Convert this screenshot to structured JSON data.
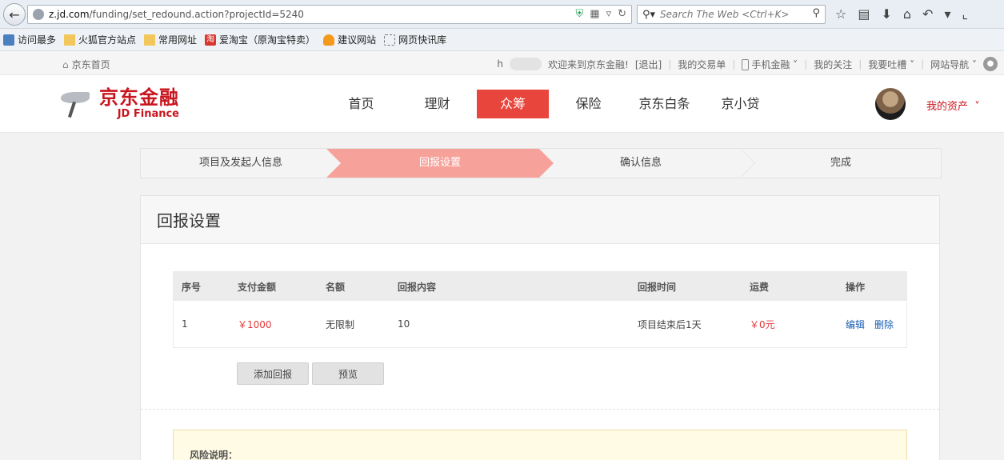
{
  "browser": {
    "url_host": "z.jd.com",
    "url_path": "/funding/set_redound.action?projectId=5240",
    "search_placeholder": "Search The Web <Ctrl+K>"
  },
  "bookmarks": [
    {
      "label": "访问最多",
      "icon": "most-visited-icon"
    },
    {
      "label": "火狐官方站点",
      "icon": "folder-icon"
    },
    {
      "label": "常用网址",
      "icon": "folder-icon"
    },
    {
      "label": "爱淘宝（原淘宝特卖）",
      "icon": "taobao-icon"
    },
    {
      "label": "建议网站",
      "icon": "bulb-icon"
    },
    {
      "label": "网页快讯库",
      "icon": "web-slice-icon"
    }
  ],
  "site_top": {
    "home": "京东首页",
    "user_initial": "h",
    "welcome": "欢迎来到京东金融!",
    "logout": "[退出]",
    "links": [
      "我的交易单",
      "手机金融",
      "我的关注",
      "我要吐槽",
      "网站导航"
    ]
  },
  "header": {
    "logo_cn": "京东金融",
    "logo_en": "JD Finance",
    "nav": [
      "首页",
      "理财",
      "众筹",
      "保险",
      "京东白条",
      "京小贷"
    ],
    "active_nav": "众筹",
    "my_assets": "我的资产"
  },
  "steps": [
    "项目及发起人信息",
    "回报设置",
    "确认信息",
    "完成"
  ],
  "panel": {
    "title": "回报设置",
    "table_headers": [
      "序号",
      "支付金额",
      "名额",
      "回报内容",
      "回报时间",
      "运费",
      "操作"
    ],
    "rows": [
      {
        "index": "1",
        "amount": "￥1000",
        "quota": "无限制",
        "content": "10",
        "time": "项目结束后1天",
        "shipping": "￥0元",
        "edit": "编辑",
        "delete": "删除"
      }
    ],
    "add_button": "添加回报",
    "preview_button": "预览",
    "risk_title": "风险说明："
  },
  "colors": {
    "brand_red": "#c9151e",
    "active_nav": "#e8453c",
    "active_step": "#f6a29b",
    "link_blue": "#1a5fb4"
  }
}
